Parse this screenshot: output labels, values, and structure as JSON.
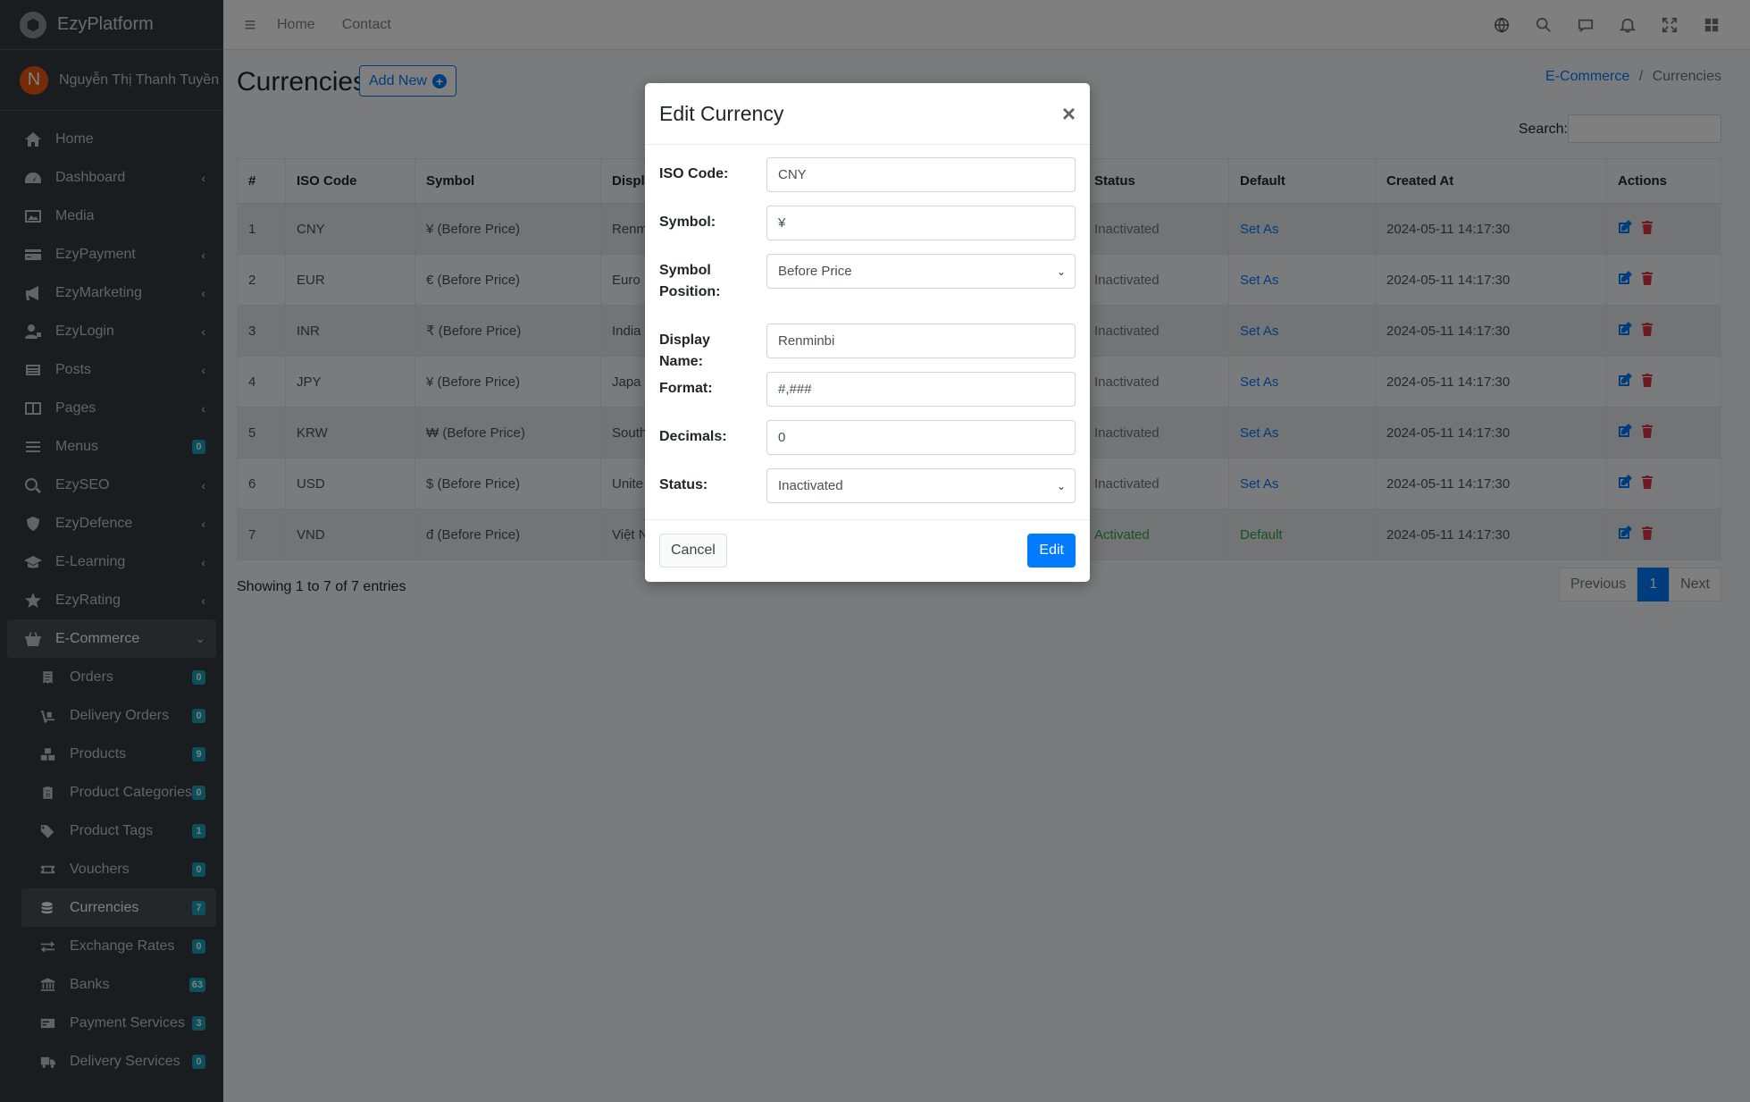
{
  "brand": {
    "name": "EzyPlatform"
  },
  "user": {
    "initial": "N",
    "name": "Nguyễn Thị Thanh Tuyền"
  },
  "sidebar": {
    "items": [
      {
        "label": "Home",
        "icon": "home-icon"
      },
      {
        "label": "Dashboard",
        "icon": "dashboard-icon",
        "chevron": "‹"
      },
      {
        "label": "Media",
        "icon": "image-icon"
      },
      {
        "label": "EzyPayment",
        "icon": "credit-card-icon",
        "chevron": "‹"
      },
      {
        "label": "EzyMarketing",
        "icon": "megaphone-icon",
        "chevron": "‹"
      },
      {
        "label": "EzyLogin",
        "icon": "user-lock-icon",
        "chevron": "‹"
      },
      {
        "label": "Posts",
        "icon": "newspaper-icon",
        "chevron": "‹"
      },
      {
        "label": "Pages",
        "icon": "book-icon",
        "chevron": "‹"
      },
      {
        "label": "Menus",
        "icon": "bars-icon",
        "badge": "0"
      },
      {
        "label": "EzySEO",
        "icon": "search-dollar-icon",
        "chevron": "‹"
      },
      {
        "label": "EzyDefence",
        "icon": "shield-icon",
        "chevron": "‹"
      },
      {
        "label": "E-Learning",
        "icon": "graduation-cap-icon",
        "chevron": "‹"
      },
      {
        "label": "EzyRating",
        "icon": "star-icon",
        "chevron": "‹"
      },
      {
        "label": "E-Commerce",
        "icon": "shopping-basket-icon",
        "chevron": "⌄"
      }
    ],
    "subitems": [
      {
        "label": "Orders",
        "icon": "receipt-icon",
        "badge": "0"
      },
      {
        "label": "Delivery Orders",
        "icon": "dolly-icon",
        "badge": "0"
      },
      {
        "label": "Products",
        "icon": "boxes-icon",
        "badge": "9"
      },
      {
        "label": "Product Categories",
        "icon": "clipboard-icon",
        "badge": "0"
      },
      {
        "label": "Product Tags",
        "icon": "tags-icon",
        "badge": "1"
      },
      {
        "label": "Vouchers",
        "icon": "ticket-icon",
        "badge": "0"
      },
      {
        "label": "Currencies",
        "icon": "coins-icon",
        "badge": "7"
      },
      {
        "label": "Exchange Rates",
        "icon": "exchange-icon",
        "badge": "0"
      },
      {
        "label": "Banks",
        "icon": "bank-icon",
        "badge": "63"
      },
      {
        "label": "Payment Services",
        "icon": "money-check-icon",
        "badge": "3"
      },
      {
        "label": "Delivery Services",
        "icon": "truck-icon",
        "badge": "0"
      }
    ]
  },
  "topnav": {
    "home": "Home",
    "contact": "Contact"
  },
  "page": {
    "title": "Currencies",
    "add_new": "Add New",
    "breadcrumb_parent": "E-Commerce",
    "breadcrumb_sep": "/",
    "breadcrumb_current": "Currencies",
    "search_label": "Search:"
  },
  "table": {
    "headers": [
      "#",
      "ISO Code",
      "Symbol",
      "Displ",
      "Status",
      "Default",
      "Created At",
      "Actions"
    ],
    "rows": [
      {
        "no": "1",
        "iso": "CNY",
        "symbol": "¥ (Before Price)",
        "display": "Renm",
        "status": "Inactivated",
        "default": "Set As",
        "created": "2024-05-11 14:17:30"
      },
      {
        "no": "2",
        "iso": "EUR",
        "symbol": "€ (Before Price)",
        "display": "Euro",
        "status": "Inactivated",
        "default": "Set As",
        "created": "2024-05-11 14:17:30"
      },
      {
        "no": "3",
        "iso": "INR",
        "symbol": "₹ (Before Price)",
        "display": "India",
        "status": "Inactivated",
        "default": "Set As",
        "created": "2024-05-11 14:17:30"
      },
      {
        "no": "4",
        "iso": "JPY",
        "symbol": "¥ (Before Price)",
        "display": "Japa",
        "status": "Inactivated",
        "default": "Set As",
        "created": "2024-05-11 14:17:30"
      },
      {
        "no": "5",
        "iso": "KRW",
        "symbol": "₩ (Before Price)",
        "display": "South",
        "status": "Inactivated",
        "default": "Set As",
        "created": "2024-05-11 14:17:30"
      },
      {
        "no": "6",
        "iso": "USD",
        "symbol": "$ (Before Price)",
        "display": "Unite",
        "status": "Inactivated",
        "default": "Set As",
        "created": "2024-05-11 14:17:30"
      },
      {
        "no": "7",
        "iso": "VND",
        "symbol": "đ (Before Price)",
        "display": "Việt N",
        "status": "Activated",
        "default": "Default",
        "created": "2024-05-11 14:17:30"
      }
    ],
    "entries": "Showing 1 to 7 of 7 entries",
    "pager": {
      "prev": "Previous",
      "current": "1",
      "next": "Next"
    }
  },
  "modal": {
    "title": "Edit Currency",
    "close": "×",
    "fields": {
      "iso_label": "ISO Code:",
      "iso_value": "CNY",
      "symbol_label": "Symbol:",
      "symbol_value": "¥",
      "position_label": "Symbol Position:",
      "position_value": "Before Price",
      "display_label": "Display Name:",
      "display_value": "Renminbi",
      "format_label": "Format:",
      "format_value": "#,###",
      "decimals_label": "Decimals:",
      "decimals_value": "0",
      "status_label": "Status:",
      "status_value": "Inactivated"
    },
    "cancel": "Cancel",
    "edit": "Edit"
  },
  "colors": {
    "primary": "#007bff",
    "danger": "#dc3545",
    "success": "#28a745",
    "sidebar": "#343a40",
    "badge": "#17a2b8"
  }
}
